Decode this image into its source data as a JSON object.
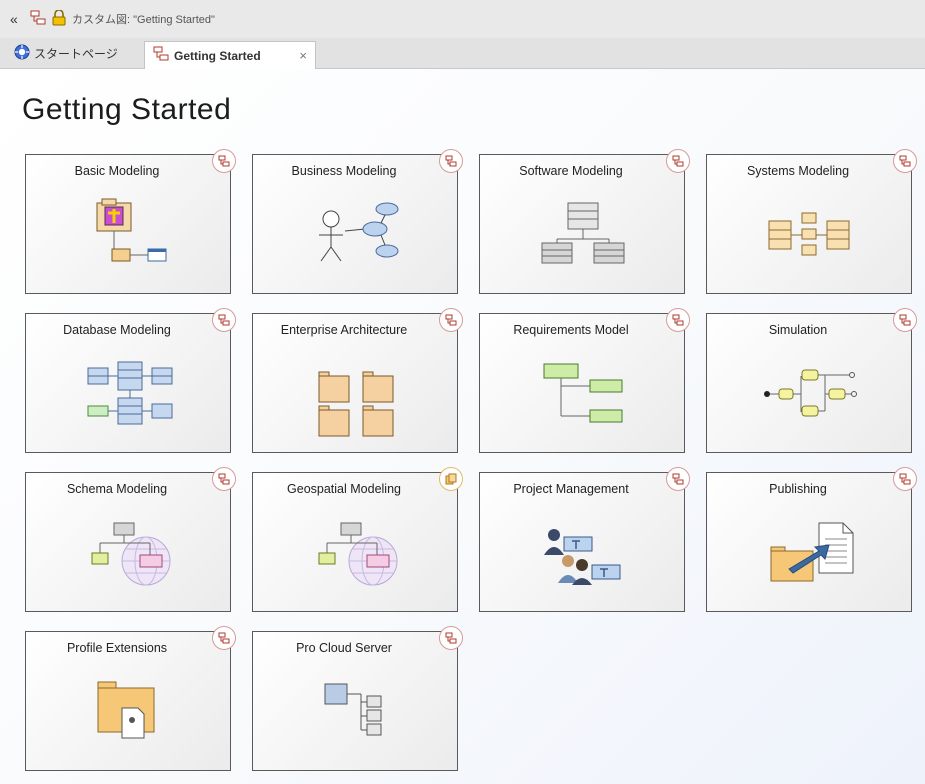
{
  "titlebar": {
    "collapse_glyph": "«",
    "title": "カスタム図: \"Getting Started\""
  },
  "tabs": [
    {
      "label": "スタートページ",
      "icon": "start-page-icon",
      "active": false
    },
    {
      "label": "Getting Started",
      "icon": "diagram-icon",
      "active": true,
      "close": "×"
    }
  ],
  "page": {
    "title": "Getting Started"
  },
  "tiles": [
    {
      "label": "Basic Modeling",
      "icon": "basic-modeling-icon"
    },
    {
      "label": "Business Modeling",
      "icon": "use-case-icon"
    },
    {
      "label": "Software Modeling",
      "icon": "class-hierarchy-icon"
    },
    {
      "label": "Systems Modeling",
      "icon": "block-diagram-icon"
    },
    {
      "label": "Database Modeling",
      "icon": "database-tables-icon"
    },
    {
      "label": "Enterprise Architecture",
      "icon": "package-folders-icon"
    },
    {
      "label": "Requirements Model",
      "icon": "requirements-tree-icon"
    },
    {
      "label": "Simulation",
      "icon": "activity-flow-icon"
    },
    {
      "label": "Schema Modeling",
      "icon": "schema-globe-icon"
    },
    {
      "label": "Geospatial Modeling",
      "icon": "geospatial-globe-icon"
    },
    {
      "label": "Project Management",
      "icon": "project-team-icon"
    },
    {
      "label": "Publishing",
      "icon": "publish-document-icon"
    },
    {
      "label": "Profile Extensions",
      "icon": "profile-package-icon"
    },
    {
      "label": "Pro Cloud Server",
      "icon": "cloud-server-icon"
    }
  ],
  "colors": {
    "badge_border": "#d69a9a",
    "badge_icon": "#b03a2e",
    "badge_alt": "#e8a33d",
    "tile_border": "#5a5a5a",
    "title_text": "#1c1c1c"
  }
}
